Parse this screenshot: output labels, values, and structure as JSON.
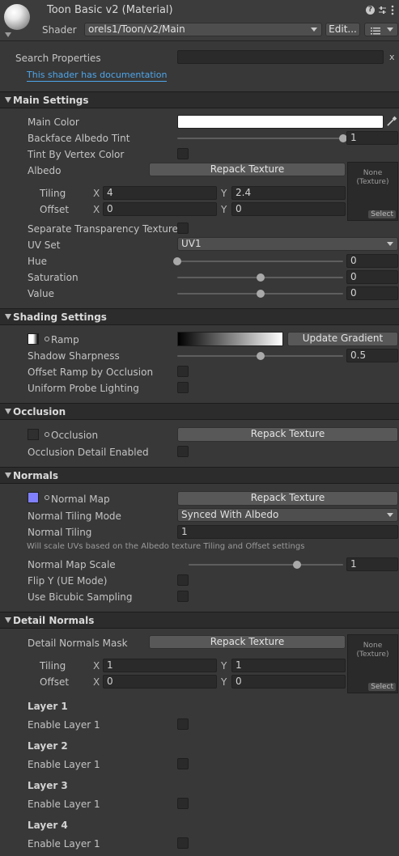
{
  "header": {
    "title": "Toon Basic v2 (Material)",
    "shader_label": "Shader",
    "shader_value": "orels1/Toon/v2/Main",
    "edit_label": "Edit..."
  },
  "search": {
    "label": "Search Properties",
    "value": "",
    "clear": "x",
    "doc_link": "This shader has documentation"
  },
  "main_settings": {
    "title": "Main Settings",
    "main_color_label": "Main Color",
    "backface_label": "Backface Albedo Tint",
    "backface_value": "1",
    "tint_vertex_label": "Tint By Vertex Color",
    "albedo_label": "Albedo",
    "repack_label": "Repack Texture",
    "tex_none": "None",
    "tex_type": "(Texture)",
    "tex_select": "Select",
    "tiling_label": "Tiling",
    "offset_label": "Offset",
    "x_label": "X",
    "y_label": "Y",
    "tiling_x": "4",
    "tiling_y": "2.4",
    "offset_x": "0",
    "offset_y": "0",
    "sep_transparency_label": "Separate Transparency Texture",
    "uvset_label": "UV Set",
    "uvset_value": "UV1",
    "hue_label": "Hue",
    "hue_value": "0",
    "saturation_label": "Saturation",
    "saturation_value": "0",
    "value_label": "Value",
    "value_value": "0"
  },
  "shading_settings": {
    "title": "Shading Settings",
    "ramp_label": "Ramp",
    "update_gradient_label": "Update Gradient",
    "shadow_sharpness_label": "Shadow Sharpness",
    "shadow_sharpness_value": "0.5",
    "offset_ramp_label": "Offset Ramp by Occlusion",
    "uniform_probe_label": "Uniform Probe Lighting"
  },
  "occlusion": {
    "title": "Occlusion",
    "occlusion_label": "Occlusion",
    "repack_label": "Repack Texture",
    "detail_enabled_label": "Occlusion Detail Enabled"
  },
  "normals": {
    "title": "Normals",
    "normal_map_label": "Normal Map",
    "repack_label": "Repack Texture",
    "tiling_mode_label": "Normal Tiling Mode",
    "tiling_mode_value": "Synced With Albedo",
    "normal_tiling_label": "Normal Tiling",
    "normal_tiling_value": "1",
    "help_text": "Will scale UVs based on the Albedo texture Tiling and Offset settings",
    "map_scale_label": "Normal Map Scale",
    "map_scale_value": "1",
    "flip_y_label": "Flip Y (UE Mode)",
    "bicubic_label": "Use Bicubic Sampling"
  },
  "detail_normals": {
    "title": "Detail Normals",
    "mask_label": "Detail Normals Mask",
    "repack_label": "Repack Texture",
    "tex_none": "None",
    "tex_type": "(Texture)",
    "tex_select": "Select",
    "tiling_label": "Tiling",
    "offset_label": "Offset",
    "x_label": "X",
    "y_label": "Y",
    "tiling_x": "1",
    "tiling_y": "1",
    "offset_x": "0",
    "offset_y": "0"
  },
  "layers": [
    {
      "title": "Layer 1",
      "enable_label": "Enable Layer 1"
    },
    {
      "title": "Layer 2",
      "enable_label": "Enable Layer 1"
    },
    {
      "title": "Layer 3",
      "enable_label": "Enable Layer 1"
    },
    {
      "title": "Layer 4",
      "enable_label": "Enable Layer 1"
    }
  ],
  "sliders": {
    "backface": 1.0,
    "hue": 0.0,
    "saturation": 0.5,
    "value": 0.5,
    "shadow_sharpness": 0.5,
    "normal_map_scale": 0.7
  },
  "colors": {
    "main_color": "#ffffff",
    "normal_map_swatch": "#8080ff",
    "link": "#4ea6ea",
    "panel_bg": "#383838",
    "section_bg": "#2c2c2c"
  },
  "icons": [
    "help-icon",
    "settings-sliders-icon",
    "more-vert-icon",
    "eyedropper-icon",
    "menu-list-icon",
    "chevron-down-icon"
  ]
}
